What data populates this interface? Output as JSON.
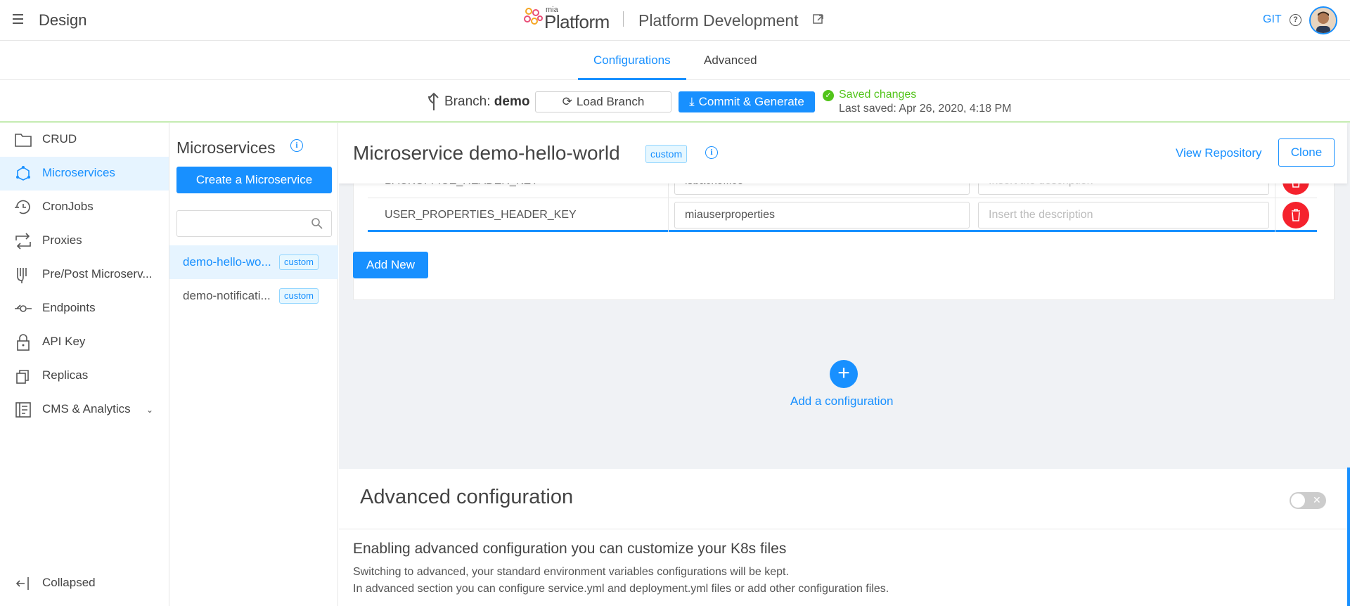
{
  "header": {
    "app_title": "Design",
    "logo_small": "mia",
    "logo_big": "Platform",
    "project_title": "Platform Development",
    "git_label": "GIT",
    "help_glyph": "?"
  },
  "tabs": [
    {
      "label": "Configurations",
      "active": true
    },
    {
      "label": "Advanced",
      "active": false
    }
  ],
  "branch": {
    "label": "Branch:",
    "name": "demo",
    "load_button": "Load Branch",
    "commit_button": "Commit & Generate",
    "status": "Saved changes",
    "last_saved": "Last saved:  Apr 26, 2020, 4:18 PM"
  },
  "sidebar": {
    "items": [
      {
        "label": "CRUD",
        "icon": "folder-icon"
      },
      {
        "label": "Microservices",
        "icon": "microservices-icon",
        "active": true
      },
      {
        "label": "CronJobs",
        "icon": "cronjobs-icon"
      },
      {
        "label": "Proxies",
        "icon": "proxies-icon"
      },
      {
        "label": "Pre/Post Microserv...",
        "icon": "prepost-icon"
      },
      {
        "label": "Endpoints",
        "icon": "endpoints-icon"
      },
      {
        "label": "API Key",
        "icon": "lock-icon"
      },
      {
        "label": "Replicas",
        "icon": "replicas-icon"
      },
      {
        "label": "CMS & Analytics",
        "icon": "cms-icon"
      }
    ],
    "collapsed_label": "Collapsed"
  },
  "microservices": {
    "title": "Microservices",
    "create_button": "Create a Microservice",
    "search_placeholder": "",
    "items": [
      {
        "name": "demo-hello-wo...",
        "tag": "custom",
        "active": true
      },
      {
        "name": "demo-notificati...",
        "tag": "custom",
        "active": false
      }
    ]
  },
  "main": {
    "title": "Microservice demo-hello-world",
    "tag": "custom",
    "view_repository": "View Repository",
    "clone_button": "Clone",
    "env_rows": [
      {
        "key": "BACKOFFICE_HEADER_KEY",
        "value": "isbackoffice",
        "description_placeholder": "Insert the description"
      },
      {
        "key": "USER_PROPERTIES_HEADER_KEY",
        "value": "miauserproperties",
        "description_placeholder": "Insert the description"
      }
    ],
    "add_new_button": "Add New",
    "add_configuration": "Add a configuration",
    "advanced": {
      "title": "Advanced configuration",
      "subtitle": "Enabling advanced configuration you can customize your K8s files",
      "line1": "Switching to advanced, your standard environment variables configurations will be kept.",
      "line2": "In advanced section you can configure service.yml and deployment.yml files or add other configuration files.",
      "enabled": false
    }
  },
  "colors": {
    "accent": "#1890ff",
    "success": "#52c41a",
    "danger": "#f5222d"
  }
}
